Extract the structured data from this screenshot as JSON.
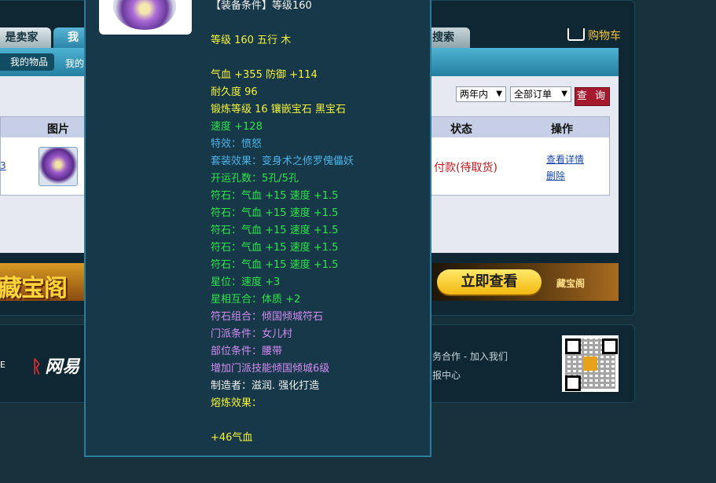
{
  "tabs": {
    "seller": "是卖家",
    "mine": "我",
    "search": "搜索"
  },
  "cart": {
    "label": "购物车",
    "icon": "cart-icon"
  },
  "subnav": {
    "my_items": "我的物品",
    "next": "我的"
  },
  "filters": {
    "time_range": "两年内",
    "order_type": "全部订单",
    "query_button": "查 询"
  },
  "table": {
    "headers": {
      "image": "图片",
      "status": "状态",
      "action": "操作"
    },
    "row": {
      "left_link": "3",
      "status": "付款(待取货)",
      "view_detail": "查看详情",
      "delete": "删除"
    }
  },
  "banner": {
    "left_text": "藏宝阁",
    "button": "立即查看",
    "logo": "藏宝阁"
  },
  "footer": {
    "logo_text": "网易",
    "links_line1": "务合作 - 加入我们",
    "links_line2": "报中心",
    "edge_text": "E"
  },
  "tooltip": {
    "lines": [
      {
        "text": "【装备条件】等级160",
        "color": "white"
      },
      {
        "text": "等级 160 五行 木",
        "color": "yellow"
      },
      {
        "text": "气血 +355 防御 +114",
        "color": "yellow"
      },
      {
        "text": "耐久度 96",
        "color": "yellow"
      },
      {
        "text": "锻炼等级 16 镶嵌宝石 黑宝石",
        "color": "yellow"
      },
      {
        "text": "速度 +128",
        "color": "green"
      },
      {
        "text": "特效：愤怒",
        "color": "blue"
      },
      {
        "text": "套装效果：变身术之修罗傀儡妖",
        "color": "blue"
      },
      {
        "text": "开运孔数：5孔/5孔",
        "color": "green"
      },
      {
        "text": "符石：气血 +15 速度 +1.5",
        "color": "green"
      },
      {
        "text": "符石：气血 +15 速度 +1.5",
        "color": "green"
      },
      {
        "text": "符石：气血 +15 速度 +1.5",
        "color": "green"
      },
      {
        "text": "符石：气血 +15 速度 +1.5",
        "color": "green"
      },
      {
        "text": "符石：气血 +15 速度 +1.5",
        "color": "green"
      },
      {
        "text": "星位：速度 +3",
        "color": "green"
      },
      {
        "text": "星相互合：体质 +2",
        "color": "green"
      },
      {
        "text": "符石组合：倾国倾城符石",
        "color": "purple"
      },
      {
        "text": "门派条件：女儿村",
        "color": "purple"
      },
      {
        "text": "部位条件：腰带",
        "color": "purple"
      },
      {
        "text": "增加门派技能倾国倾城6级",
        "color": "purple"
      },
      {
        "text": "制造者：滋润. 强化打造",
        "color": "white"
      },
      {
        "text": "熔炼效果：",
        "color": "yellow"
      },
      {
        "text": "+46气血",
        "color": "yellow"
      }
    ]
  },
  "colors": {
    "yellow": "#f4f33b",
    "green": "#2fe54a",
    "blue": "#4db2e8",
    "purple": "#d38cf3",
    "white": "#f2f2f2",
    "status_red": "#c4161c"
  }
}
